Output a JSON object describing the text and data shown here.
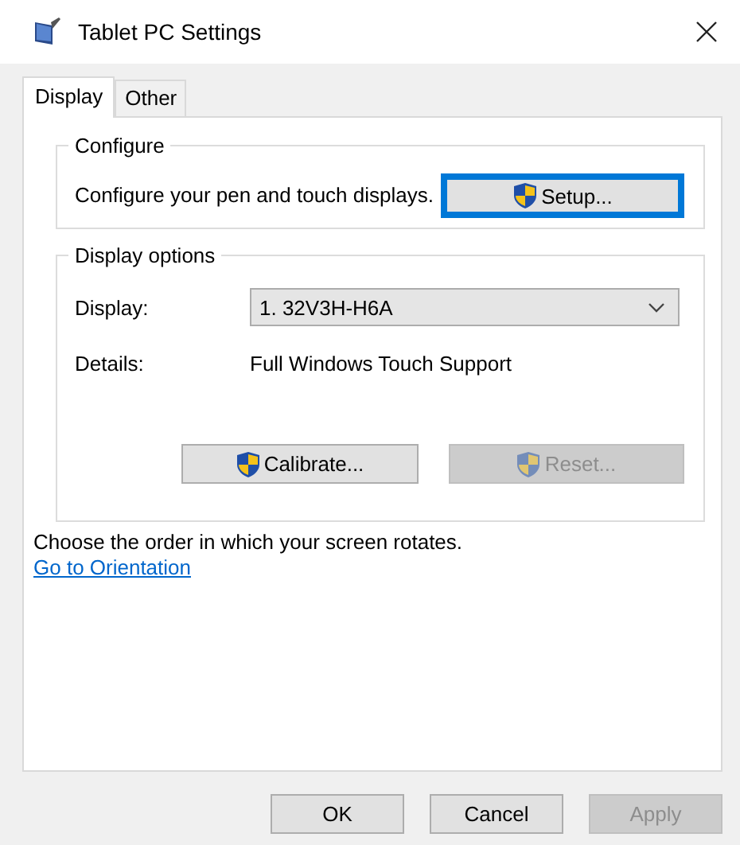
{
  "window": {
    "title": "Tablet PC Settings"
  },
  "tabs": [
    {
      "label": "Display",
      "selected": true
    },
    {
      "label": "Other",
      "selected": false
    }
  ],
  "configure": {
    "title": "Configure",
    "text": "Configure your pen and touch displays.",
    "button": {
      "label": "Setup...",
      "focused": true,
      "disabled": false
    }
  },
  "display_options": {
    "title": "Display options",
    "display_label": "Display:",
    "display_value": "1. 32V3H-H6A",
    "details_label": "Details:",
    "details_value": "Full Windows Touch Support",
    "buttons": [
      {
        "label": "Calibrate...",
        "disabled": false
      },
      {
        "label": "Reset...",
        "disabled": true
      }
    ]
  },
  "orientation": {
    "text": "Choose the order in which your screen rotates.",
    "link": "Go to Orientation"
  },
  "buttons": [
    {
      "label": "OK",
      "disabled": false
    },
    {
      "label": "Cancel",
      "disabled": false
    },
    {
      "label": "Apply",
      "disabled": true
    }
  ]
}
